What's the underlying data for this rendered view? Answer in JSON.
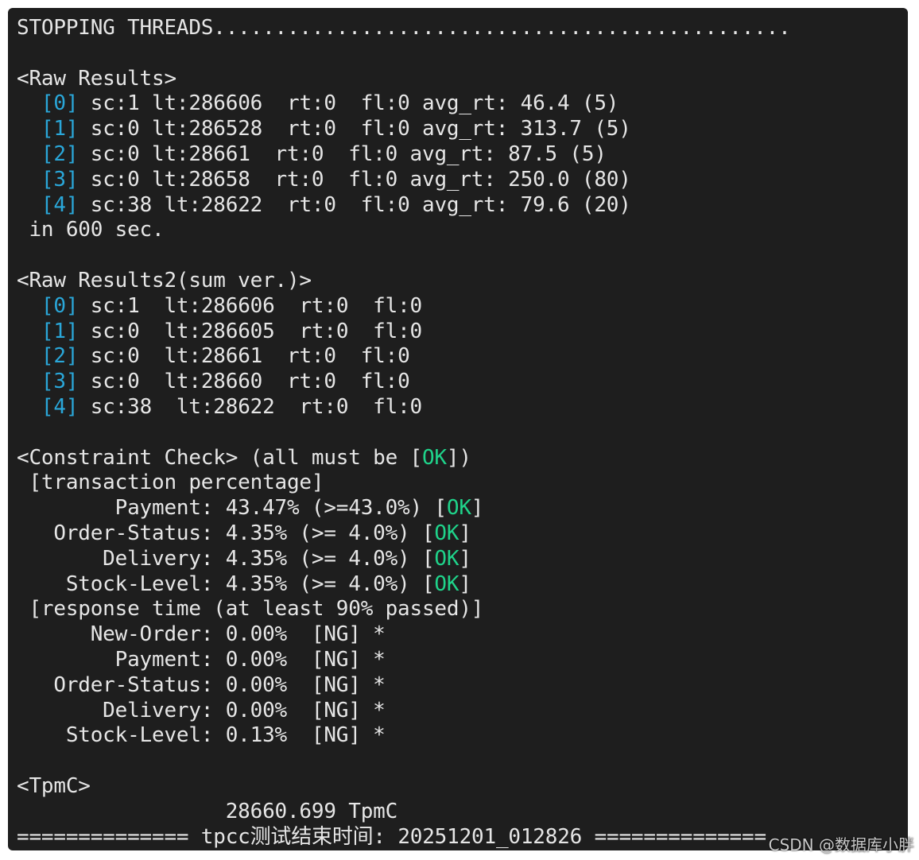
{
  "terminal": {
    "lines": [
      "STOPPING THREADS...............................................",
      "",
      "<Raw Results>",
      "  [0] sc:1 lt:286606  rt:0  fl:0 avg_rt: 46.4 (5)",
      "  [1] sc:0 lt:286528  rt:0  fl:0 avg_rt: 313.7 (5)",
      "  [2] sc:0 lt:28661  rt:0  fl:0 avg_rt: 87.5 (5)",
      "  [3] sc:0 lt:28658  rt:0  fl:0 avg_rt: 250.0 (80)",
      "  [4] sc:38 lt:28622  rt:0  fl:0 avg_rt: 79.6 (20)",
      " in 600 sec.",
      "",
      "<Raw Results2(sum ver.)>",
      "  [0] sc:1  lt:286606  rt:0  fl:0",
      "  [1] sc:0  lt:286605  rt:0  fl:0",
      "  [2] sc:0  lt:28661  rt:0  fl:0",
      "  [3] sc:0  lt:28660  rt:0  fl:0",
      "  [4] sc:38  lt:28622  rt:0  fl:0",
      "",
      "<Constraint Check> (all must be [OK])",
      " [transaction percentage]",
      "        Payment: 43.47% (>=43.0%) [OK]",
      "   Order-Status: 4.35% (>= 4.0%) [OK]",
      "       Delivery: 4.35% (>= 4.0%) [OK]",
      "    Stock-Level: 4.35% (>= 4.0%) [OK]",
      " [response time (at least 90% passed)]",
      "      New-Order: 0.00%  [NG] *",
      "        Payment: 0.00%  [NG] *",
      "   Order-Status: 0.00%  [NG] *",
      "       Delivery: 0.00%  [NG] *",
      "    Stock-Level: 0.13%  [NG] *",
      "",
      "<TpmC>",
      "                 28660.699 TpmC",
      "============== tpcc测试结束时间: 20251201_012826 =============="
    ]
  },
  "watermark": "CSDN @数据库小胖",
  "colors": {
    "background": "#1e1e1e",
    "text": "#e6e6e6",
    "index_bracket": "#2aa7d9",
    "ok": "#1fd38a"
  }
}
